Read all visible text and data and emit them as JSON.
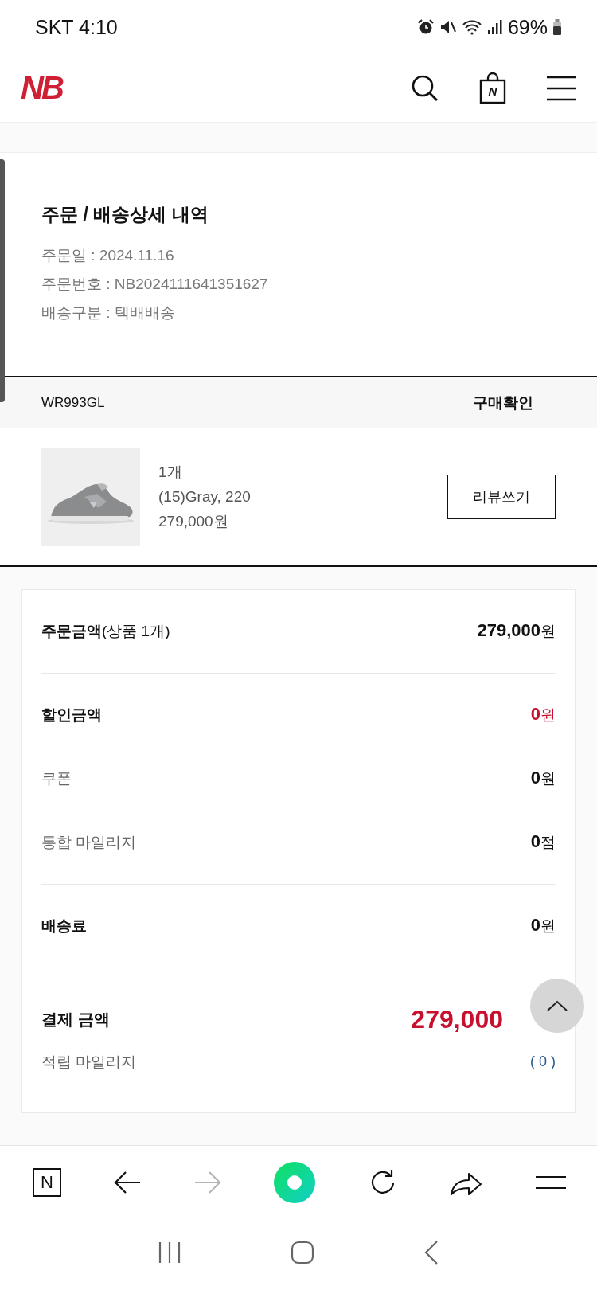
{
  "status_bar": {
    "carrier_time": "SKT 4:10",
    "battery": "69%"
  },
  "header": {
    "logo": "NB",
    "cart_letter": "N"
  },
  "order": {
    "title": "주문 / 배송상세 내역",
    "lines": [
      "주문일 : 2024.11.16",
      "주문번호 : NB2024111641351627",
      "배송구분 : 택배배송"
    ]
  },
  "item": {
    "code": "WR993GL",
    "status": "구매확인",
    "details": [
      "1개",
      "(15)Gray, 220",
      "279,000원"
    ],
    "button": "리뷰쓰기"
  },
  "summary": {
    "groups": [
      [
        {
          "kind": "head",
          "label": "주문금액",
          "note": "(상품 1개)",
          "value": "**279,000**원",
          "highlight": false
        }
      ],
      [
        {
          "kind": "head",
          "label": "할인금액",
          "value": "**0**원",
          "highlight": true
        },
        {
          "kind": "sub",
          "label": "쿠폰",
          "value": "**0**원",
          "highlight": false
        },
        {
          "kind": "sub",
          "label": "통합 마일리지",
          "value": "**0**점",
          "highlight": false
        }
      ],
      [
        {
          "kind": "head",
          "label": "배송료",
          "value": "**0**원",
          "highlight": false
        }
      ]
    ],
    "total": {
      "label": "결제 금액",
      "value": "279,000",
      "mileage_label": "적립 마일리지",
      "mileage_value": "( 0 )"
    }
  },
  "browser_toolbar": {
    "home_letter": "N",
    "forward_disabled": true
  }
}
